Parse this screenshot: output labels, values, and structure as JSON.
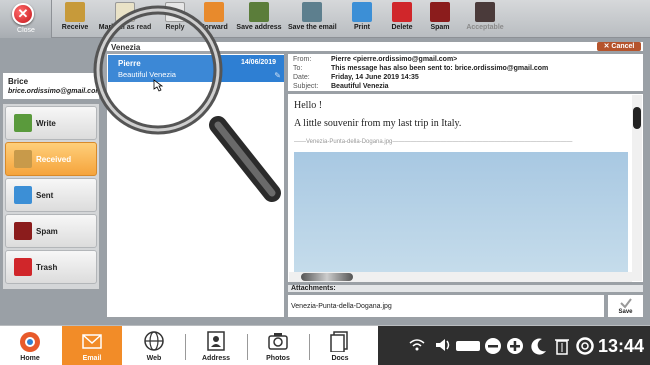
{
  "toolbar": {
    "close": "Close",
    "receive": "Receive",
    "mark_all_read": "Mark all as read",
    "reply": "Reply",
    "forward": "Forward",
    "save_address": "Save address",
    "save_email": "Save the email",
    "print": "Print",
    "delete": "Delete",
    "spam": "Spam",
    "acceptable": "Acceptable"
  },
  "user": {
    "name": "Brice",
    "email": "brice.ordissimo@gmail.com"
  },
  "folders": [
    {
      "label": "Write",
      "icon": "pencil-icon"
    },
    {
      "label": "Received",
      "icon": "envelope-arrow-icon"
    },
    {
      "label": "Sent",
      "icon": "upload-arrow-icon"
    },
    {
      "label": "Spam",
      "icon": "spam-bin-icon"
    },
    {
      "label": "Trash",
      "icon": "trash-icon"
    }
  ],
  "search": {
    "value": "Venezia",
    "cancel_label": "Cancel"
  },
  "messages": [
    {
      "sender": "Pierre",
      "date": "14/06/2019",
      "subject": "Beautiful Venezia"
    }
  ],
  "email": {
    "from_label": "From:",
    "from": "Pierre <pierre.ordissimo@gmail.com>",
    "to_label": "To:",
    "to": "This message has also been sent to: brice.ordissimo@gmail.com",
    "date_label": "Date:",
    "date": "Friday, 14 June 2019 14:35",
    "subject_label": "Subject:",
    "subject": "Beautiful Venezia",
    "body_line1": "Hello !",
    "body_line2": "A little souvenir from my last trip in Italy.",
    "inline_attachment": "Venezia-Punta-della-Dogana.jpg"
  },
  "attachments": {
    "header": "Attachments:",
    "file": "Venezia-Punta-della-Dogana.jpg",
    "save_label": "Save"
  },
  "taskbar": {
    "tabs": [
      "Home",
      "Email",
      "Web",
      "Address",
      "Photos",
      "Docs"
    ],
    "active": "Email",
    "clock": "13:44"
  },
  "colors": {
    "accent_orange": "#f28c28",
    "selection_blue": "#2e7fd3",
    "close_red": "#c4161c"
  }
}
